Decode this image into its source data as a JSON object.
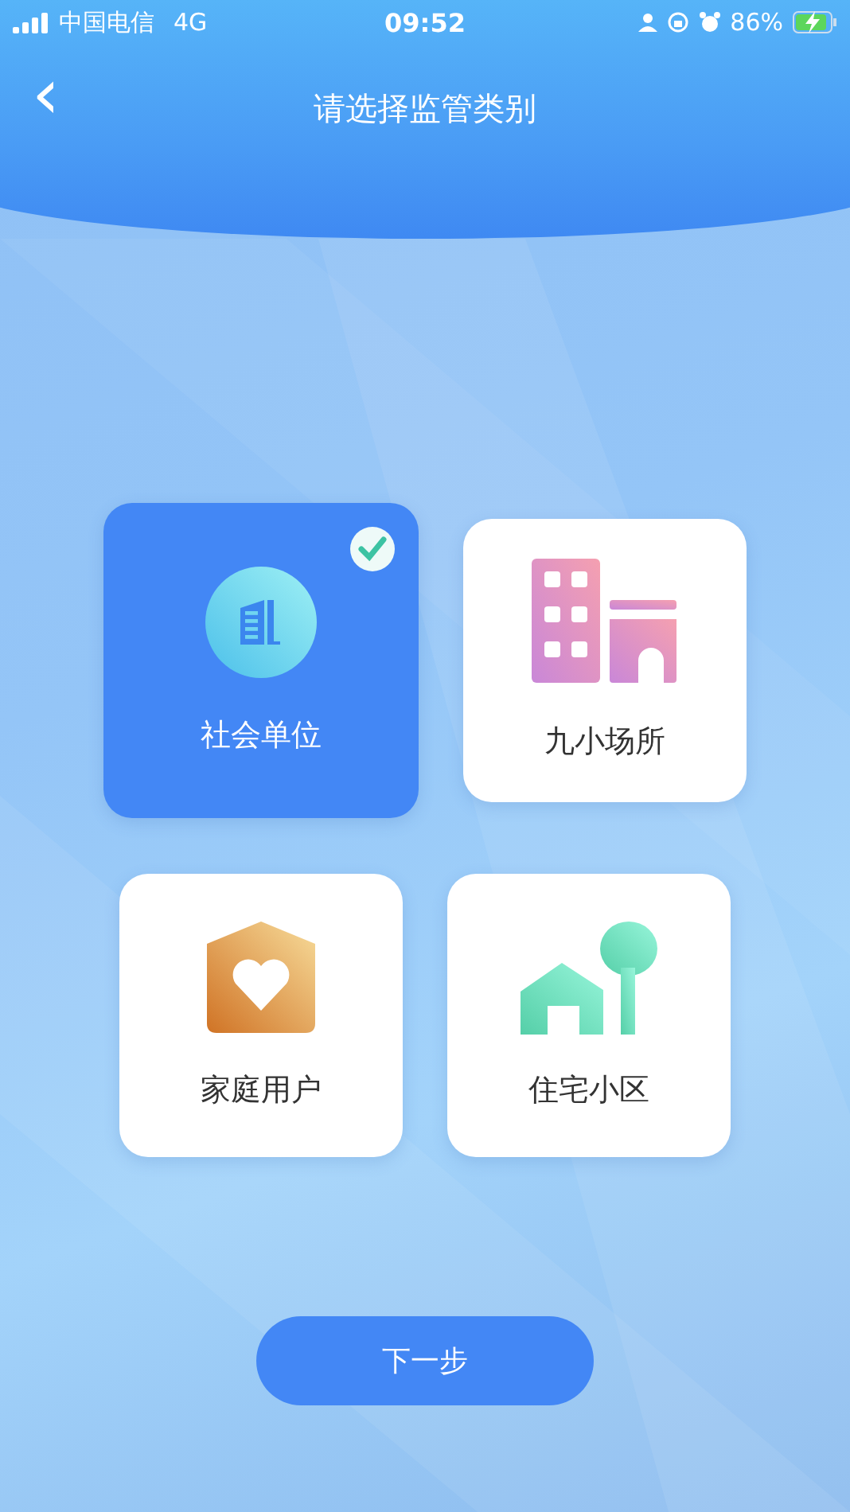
{
  "status_bar": {
    "carrier": "中国电信",
    "network": "4G",
    "time": "09:52",
    "battery": "86%"
  },
  "header": {
    "back": "‹",
    "title": "请选择监管类别"
  },
  "categories": [
    {
      "label": "社会单位",
      "kind": "office",
      "selected": true
    },
    {
      "label": "九小场所",
      "kind": "venue",
      "selected": false
    },
    {
      "label": "家庭用户",
      "kind": "home",
      "selected": false
    },
    {
      "label": "住宅小区",
      "kind": "residential",
      "selected": false
    }
  ],
  "next_button": "下一步"
}
